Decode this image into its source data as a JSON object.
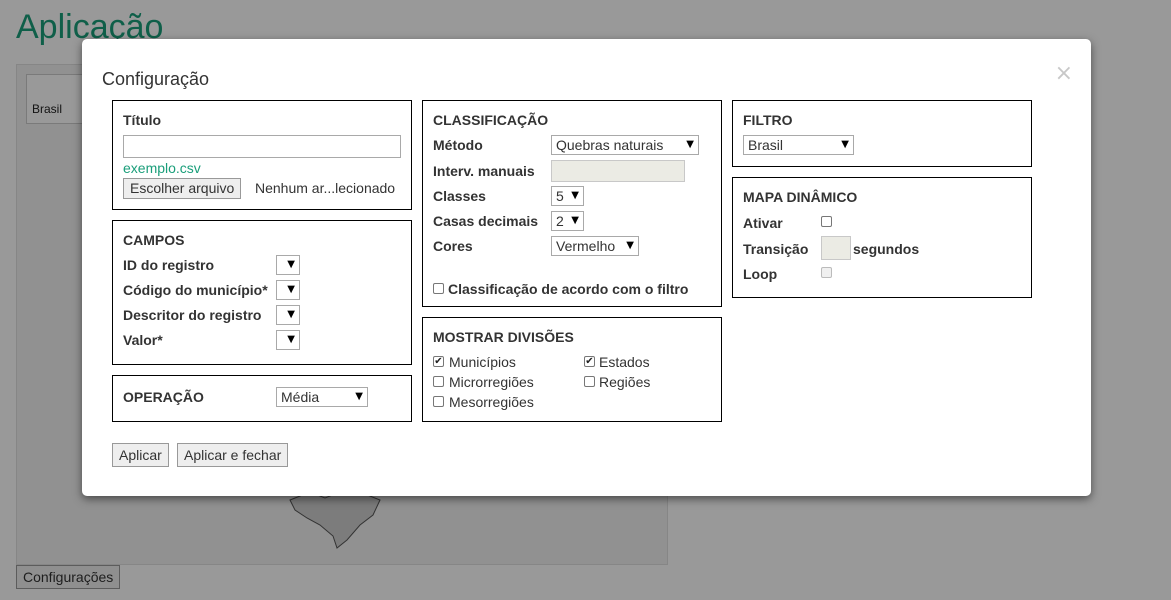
{
  "app": {
    "title": "Aplicação",
    "filter_value": "Brasil",
    "config_button": "Configurações"
  },
  "dialog": {
    "title": "Configuração",
    "close_icon": "×",
    "titulo_section": {
      "label": "Título",
      "input_value": "",
      "file_link": "exemplo.csv",
      "file_button": "Escolher arquivo",
      "file_status": "Nenhum ar...lecionado"
    },
    "campos": {
      "title": "CAMPOS",
      "fields": [
        {
          "label": "ID do registro",
          "value": ""
        },
        {
          "label": "Código do município*",
          "value": ""
        },
        {
          "label": "Descritor do registro",
          "value": ""
        },
        {
          "label": "Valor*",
          "value": ""
        }
      ]
    },
    "operacao": {
      "title": "OPERAÇÃO",
      "value": "Média"
    },
    "classificacao": {
      "title": "CLASSIFICAÇÃO",
      "metodo_label": "Método",
      "metodo_value": "Quebras naturais",
      "interv_label": "Interv. manuais",
      "classes_label": "Classes",
      "classes_value": "5",
      "casas_label": "Casas decimais",
      "casas_value": "2",
      "cores_label": "Cores",
      "cores_value": "Vermelho",
      "filter_checkbox_label": "Classificação de acordo com o filtro",
      "filter_checkbox_checked": false
    },
    "mostrar_divisoes": {
      "title": "MOSTRAR DIVISÕES",
      "options": [
        {
          "label": "Municípios",
          "checked": true
        },
        {
          "label": "Estados",
          "checked": true
        },
        {
          "label": "Microrregiões",
          "checked": false
        },
        {
          "label": "Regiões",
          "checked": false
        },
        {
          "label": "Mesorregiões",
          "checked": false
        }
      ]
    },
    "filtro": {
      "title": "FILTRO",
      "value": "Brasil"
    },
    "mapa_dinamico": {
      "title": "MAPA DINÂMICO",
      "ativar_label": "Ativar",
      "ativar_checked": false,
      "transicao_label": "Transição",
      "transicao_value": "",
      "segundos_label": "segundos",
      "loop_label": "Loop",
      "loop_checked": false
    },
    "buttons": {
      "apply": "Aplicar",
      "apply_close": "Aplicar e fechar"
    }
  },
  "colors": {
    "accent": "#1a9e7a",
    "overlay": "#666666"
  }
}
